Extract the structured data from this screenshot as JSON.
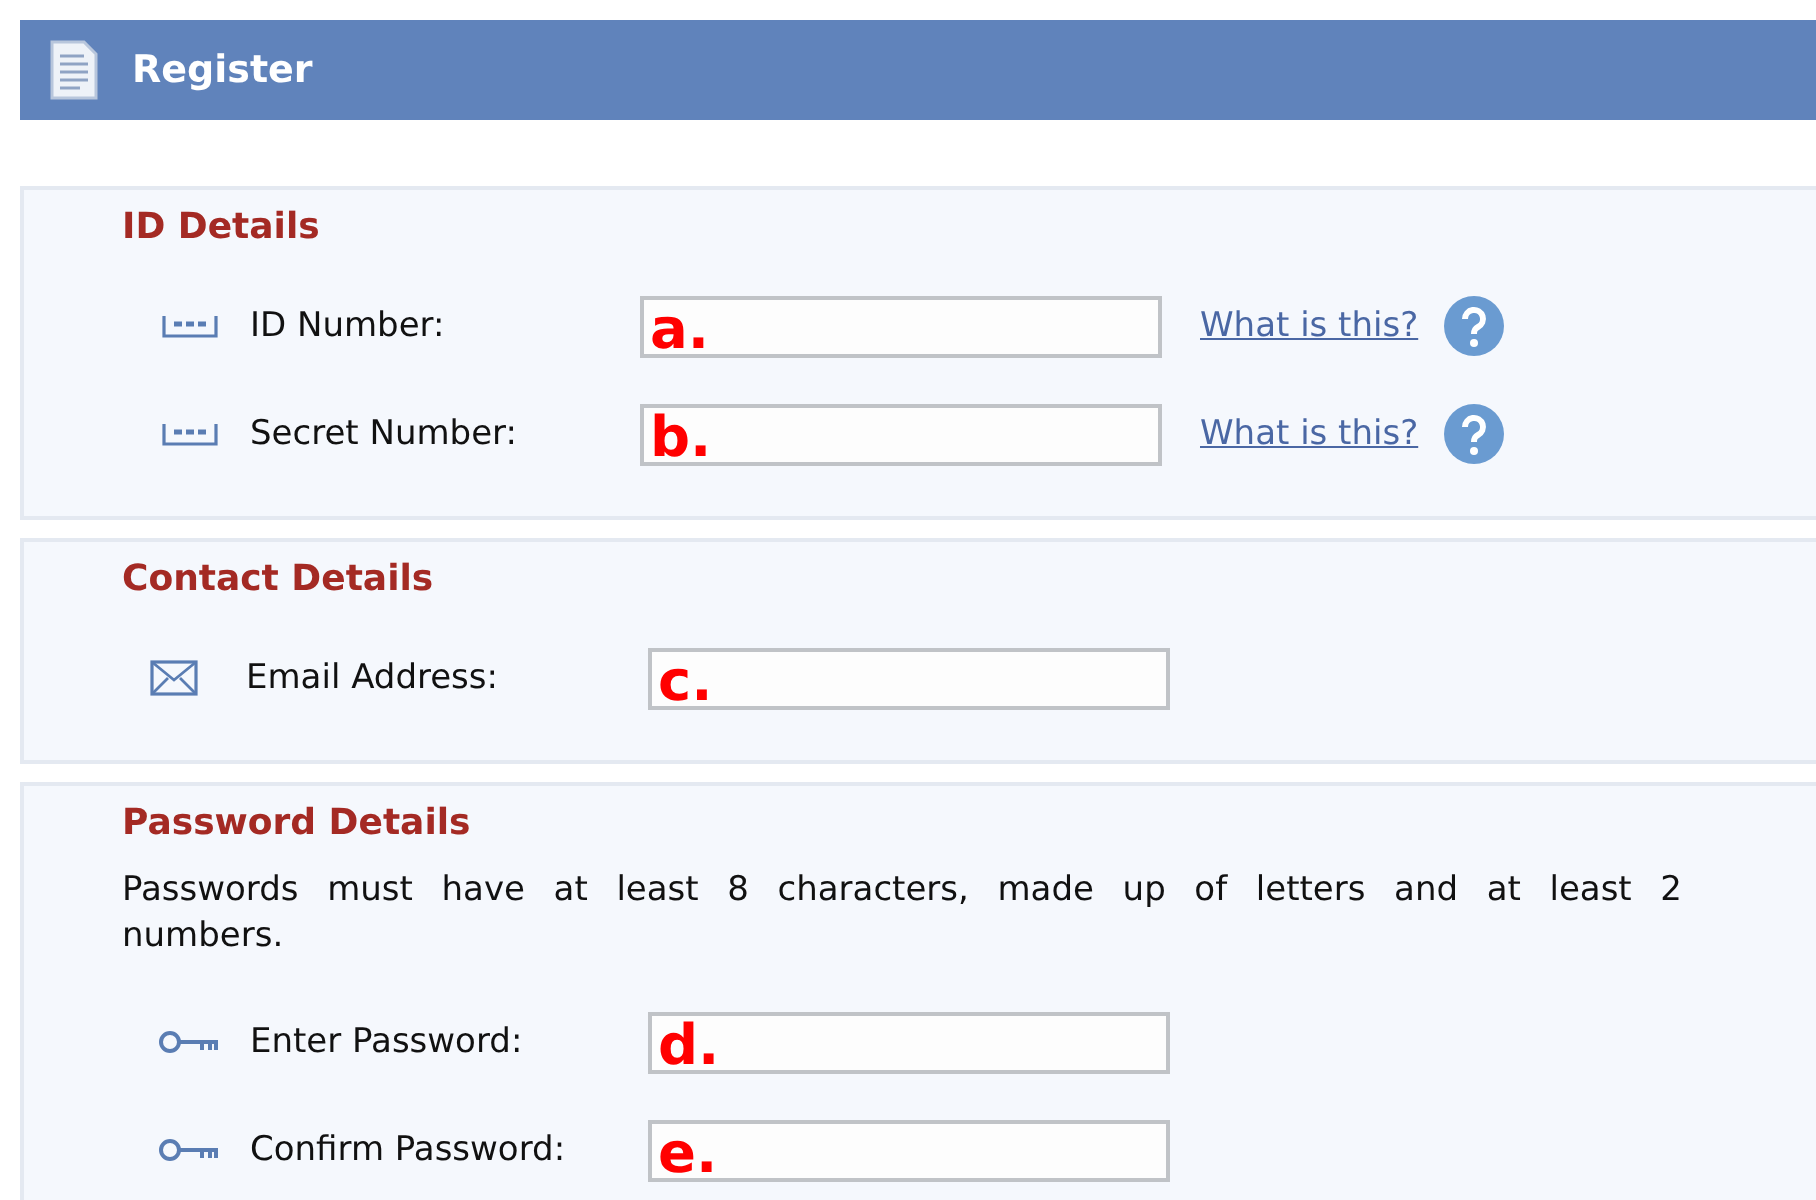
{
  "header": {
    "title": "Register"
  },
  "sections": [
    {
      "title": "ID Details",
      "fields": [
        {
          "kind": "number",
          "label": "ID Number:",
          "marker": "a.",
          "help": "What is this?"
        },
        {
          "kind": "number",
          "label": "Secret Number:",
          "marker": "b.",
          "help": "What is this?"
        }
      ]
    },
    {
      "title": "Contact Details",
      "fields": [
        {
          "kind": "email",
          "label": "Email Address:",
          "marker": "c."
        }
      ]
    },
    {
      "title": "Password Details",
      "note": "Passwords must have at least 8 characters, made up of letters and at least 2 numbers.",
      "fields": [
        {
          "kind": "password",
          "label": "Enter Password:",
          "marker": "d."
        },
        {
          "kind": "password",
          "label": "Confirm Password:",
          "marker": "e."
        }
      ]
    }
  ]
}
